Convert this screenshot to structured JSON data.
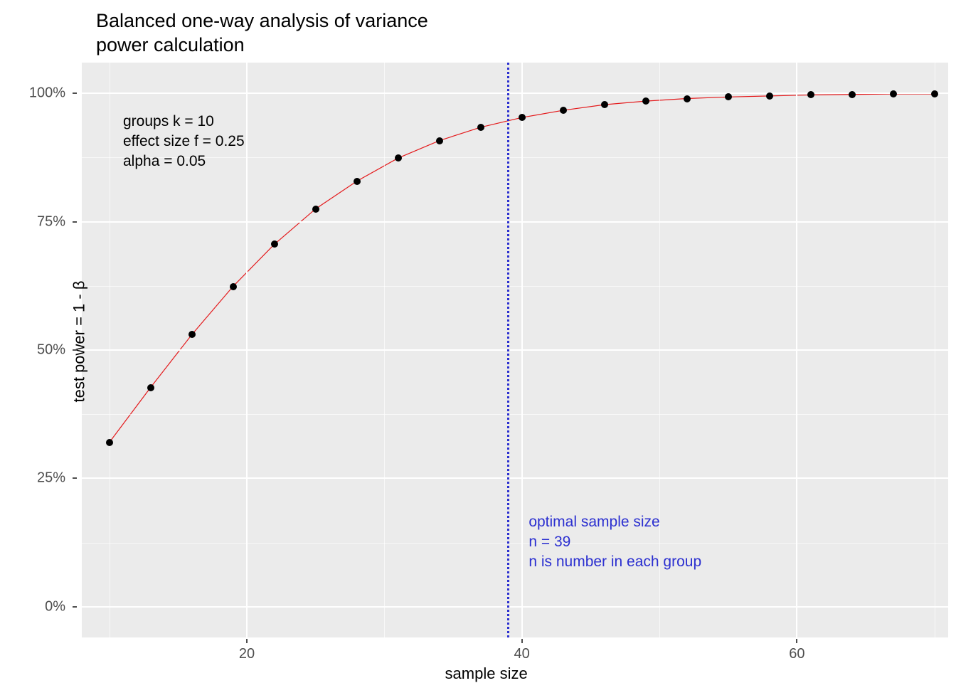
{
  "chart_data": {
    "type": "line",
    "title": "Balanced one-way analysis of variance\npower calculation",
    "xlabel": "sample size",
    "ylabel": "test power = 1 - β",
    "xlim": [
      8,
      71
    ],
    "ylim": [
      -0.06,
      1.06
    ],
    "x_ticks": [
      20,
      40,
      60
    ],
    "x_minor": [
      10,
      30,
      50,
      70
    ],
    "y_ticks": [
      0,
      0.25,
      0.5,
      0.75,
      1.0
    ],
    "y_tick_labels": [
      "0%",
      "25%",
      "50%",
      "75%",
      "100%"
    ],
    "y_minor": [
      0.125,
      0.375,
      0.625,
      0.875
    ],
    "series": [
      {
        "name": "power",
        "color": "#e41a1c",
        "x": [
          10,
          13,
          16,
          19,
          22,
          25,
          28,
          31,
          34,
          37,
          40,
          43,
          46,
          49,
          52,
          55,
          58,
          61,
          64,
          67,
          70
        ],
        "values": [
          0.32,
          0.427,
          0.53,
          0.624,
          0.706,
          0.775,
          0.829,
          0.874,
          0.908,
          0.934,
          0.953,
          0.967,
          0.978,
          0.985,
          0.99,
          0.993,
          0.995,
          0.997,
          0.998,
          0.999,
          0.999
        ]
      }
    ],
    "vline": {
      "x": 39,
      "color": "#2b2fd0",
      "style": "dotted"
    },
    "annotations": {
      "params": {
        "text": "groups k = 10\neffect size f = 0.25\nalpha = 0.05",
        "x": 11,
        "y": 0.95
      },
      "optimal": {
        "text": "optimal sample size\nn = 39\nn is number in each group",
        "x": 40.5,
        "y": 0.17
      }
    }
  }
}
